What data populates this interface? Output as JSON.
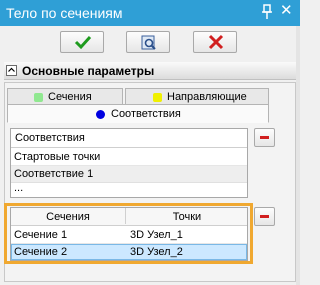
{
  "window": {
    "title": "Тело по сечениям"
  },
  "toolbar": {
    "ok_icon": "checkmark-icon",
    "preview_icon": "preview-icon",
    "cancel_icon": "cancel-icon"
  },
  "section": {
    "title": "Основные параметры"
  },
  "tabs": [
    {
      "label": "Сечения",
      "color": "#90e890"
    },
    {
      "label": "Направляющие",
      "color": "#f0f000"
    },
    {
      "label": "Соответствия",
      "color": "#0000e0",
      "active": true
    }
  ],
  "correspondence_list": {
    "header": "Соответствия",
    "items": [
      "Стартовые точки",
      "Соответствие 1",
      "..."
    ]
  },
  "sections_table": {
    "columns": [
      "Сечения",
      "Точки"
    ],
    "rows": [
      [
        "Сечение 1",
        "3D Узел_1"
      ],
      [
        "Сечение 2",
        "3D Узел_2"
      ]
    ],
    "selected_row": 1
  },
  "colors": {
    "titlebar": "#2f9fd6",
    "highlight_border": "#f0a830",
    "selection": "#cce8ff"
  }
}
